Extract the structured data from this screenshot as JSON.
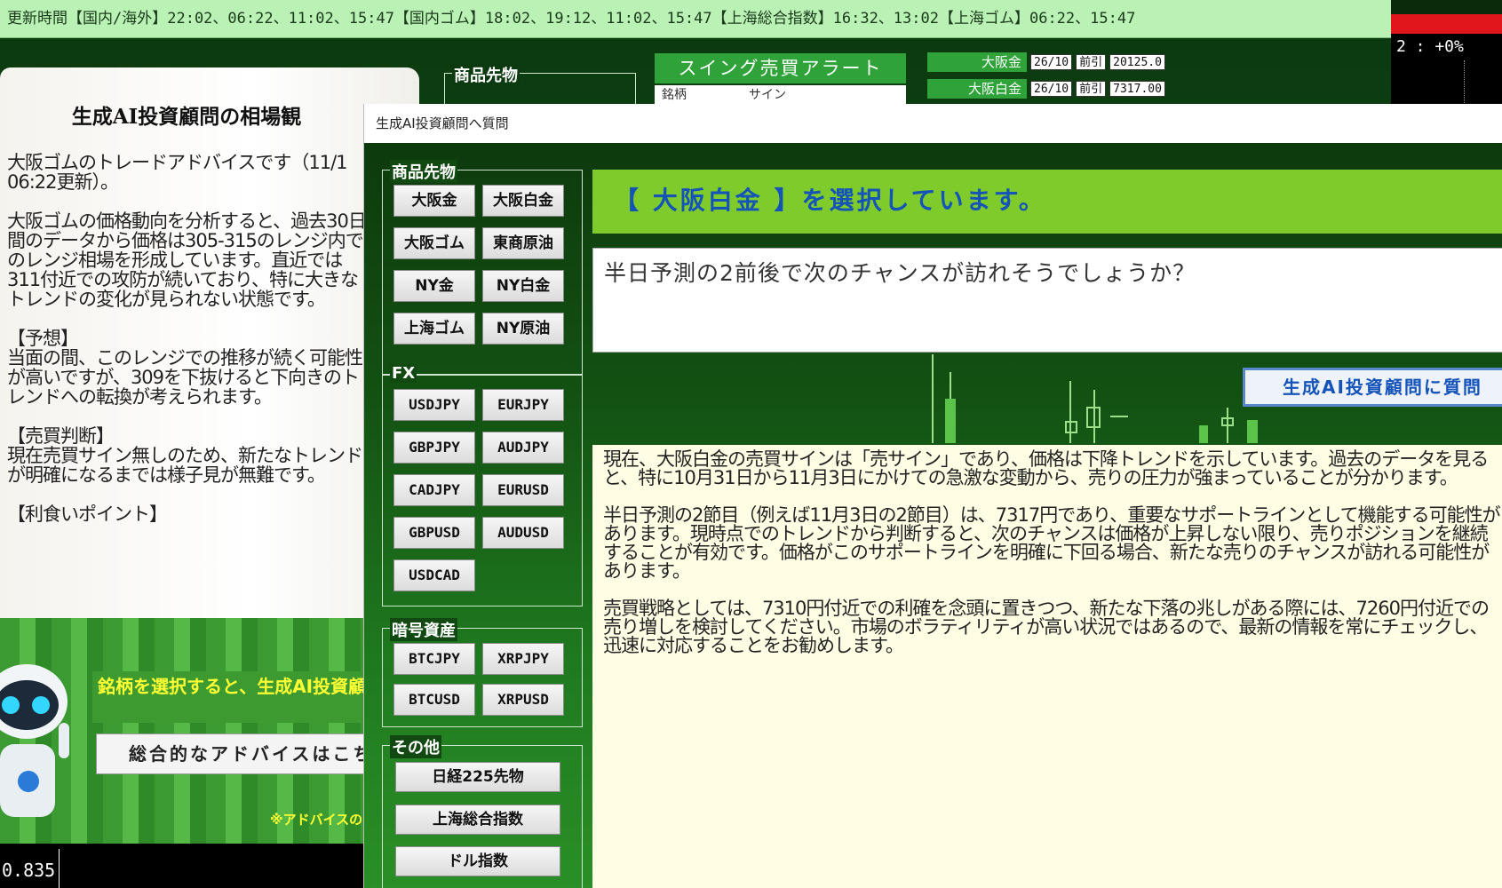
{
  "ticker": {
    "text": "更新時間【国内/海外】22:02、06:22、11:02、15:47【国内ゴム】18:02、19:12、11:02、15:47【上海総合指数】16:32、13:02【上海ゴム】06:22、15:47"
  },
  "right_panel": {
    "value": "2 :  +0%"
  },
  "background_window": {
    "group_label": "商品先物",
    "swing_alert": "スイング売買アラート",
    "swing_table_header": "銘柄　　　　　サイン",
    "quotes": [
      {
        "name": "大阪金",
        "month": "26/10",
        "tag": "前引",
        "price": "20125.0"
      },
      {
        "name": "大阪白金",
        "month": "26/10",
        "tag": "前引",
        "price": "7317.00"
      }
    ]
  },
  "left_panel": {
    "title": "生成AI投資顧問の相場観",
    "body": "大阪ゴムのトレードアドバイスです（11/1 06:22更新）。\n\n大阪ゴムの価格動向を分析すると、過去30日間のデータから価格は305-315のレンジ内でのレンジ相場を形成しています。直近では311付近での攻防が続いており、特に大きなトレンドの変化が見られない状態です。\n\n【予想】\n当面の間、このレンジでの推移が続く可能性が高いですが、309を下抜けると下向きのトレンドへの転換が考えられます。\n\n【売買判断】\n現在売買サイン無しのため、新たなトレンドが明確になるまでは様子見が無難です。\n\n【利食いポイント】",
    "yellow_message": "銘柄を選択すると、生成AI投資顧問からのアドバイスが表示されます。",
    "overall_button": "総合的なアドバイスはこちら",
    "note": "※アドバイスの",
    "chart_value": "0.835"
  },
  "dialog": {
    "title": "生成AI投資顧問へ質問",
    "groups": {
      "commodity": {
        "label": "商品先物",
        "buttons": [
          "大阪金",
          "大阪白金",
          "大阪ゴム",
          "東商原油",
          "NY金",
          "NY白金",
          "上海ゴム",
          "NY原油"
        ]
      },
      "fx": {
        "label": "FX",
        "buttons": [
          "USDJPY",
          "EURJPY",
          "GBPJPY",
          "AUDJPY",
          "CADJPY",
          "EURUSD",
          "GBPUSD",
          "AUDUSD",
          "USDCAD"
        ]
      },
      "crypto": {
        "label": "暗号資産",
        "buttons": [
          "BTCJPY",
          "XRPJPY",
          "BTCUSD",
          "XRPUSD"
        ]
      },
      "other": {
        "label": "その他",
        "buttons": [
          "日経225先物",
          "上海総合指数",
          "ドル指数"
        ]
      }
    },
    "selected_banner": "【 大阪白金 】を選択しています。",
    "question": "半日予測の2前後で次のチャンスが訪れそうでしょうか？",
    "ask_button": "生成AI投資顧問に質問",
    "answer": "現在、大阪白金の売買サインは「売サイン」であり、価格は下降トレンドを示しています。過去のデータを見ると、特に10月31日から11月3日にかけての急激な変動から、売りの圧力が強まっていることが分かります。\n\n半日予測の2節目（例えば11月3日の2節目）は、7317円であり、重要なサポートラインとして機能する可能性があります。現時点でのトレンドから判断すると、次のチャンスは価格が上昇しない限り、売りポジションを継続することが有効です。価格がこのサポートラインを明確に下回る場合、新たな売りのチャンスが訪れる可能性があります。\n\n売買戦略としては、7310円付近での利確を念頭に置きつつ、新たな下落の兆しがある際には、7260円付近での売り増しを検討してください。市場のボラティリティが高い状況ではあるので、最新の情報を常にチェックし、迅速に対応することをお勧めします。"
  },
  "colors": {
    "ticker_bg": "#b9f2b4",
    "accent_green": "#7ecb2b",
    "link_blue": "#1453b8",
    "alert_red": "#e0161a",
    "answer_bg": "#fffde4"
  }
}
